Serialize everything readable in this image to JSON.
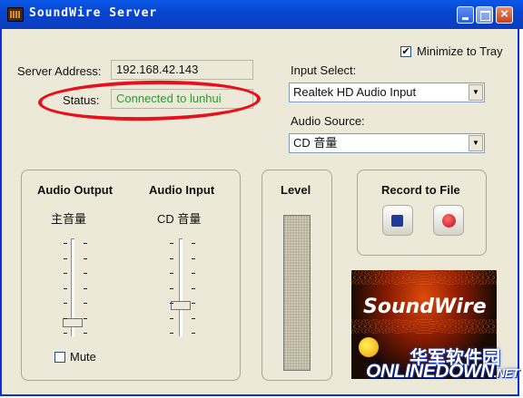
{
  "window": {
    "title": "SoundWire Server"
  },
  "server": {
    "address_label": "Server Address:",
    "address_value": "192.168.42.143",
    "status_label": "Status:",
    "status_value": "Connected to lunhui"
  },
  "tray": {
    "minimize_label": "Minimize to Tray",
    "checked": true,
    "check_glyph": "✔"
  },
  "input_select": {
    "label": "Input Select:",
    "value": "Realtek HD Audio Input"
  },
  "audio_source": {
    "label": "Audio Source:",
    "value": "CD 音量"
  },
  "audio_output": {
    "title": "Audio Output",
    "sub": "主音量",
    "level": 0.1
  },
  "audio_input": {
    "title": "Audio Input",
    "sub": "CD 音量",
    "level": 0.3
  },
  "mute": {
    "label": "Mute",
    "checked": false
  },
  "level": {
    "title": "Level"
  },
  "record": {
    "title": "Record to File"
  },
  "logo": {
    "text": "SoundWire"
  },
  "watermark": {
    "cn": "华军软件园",
    "en": "ONLINEDOWN",
    "suffix": ".NET"
  },
  "colors": {
    "titlebar": "#0a58e8",
    "status_text": "#2d9b2d",
    "highlight": "#e8101a"
  }
}
